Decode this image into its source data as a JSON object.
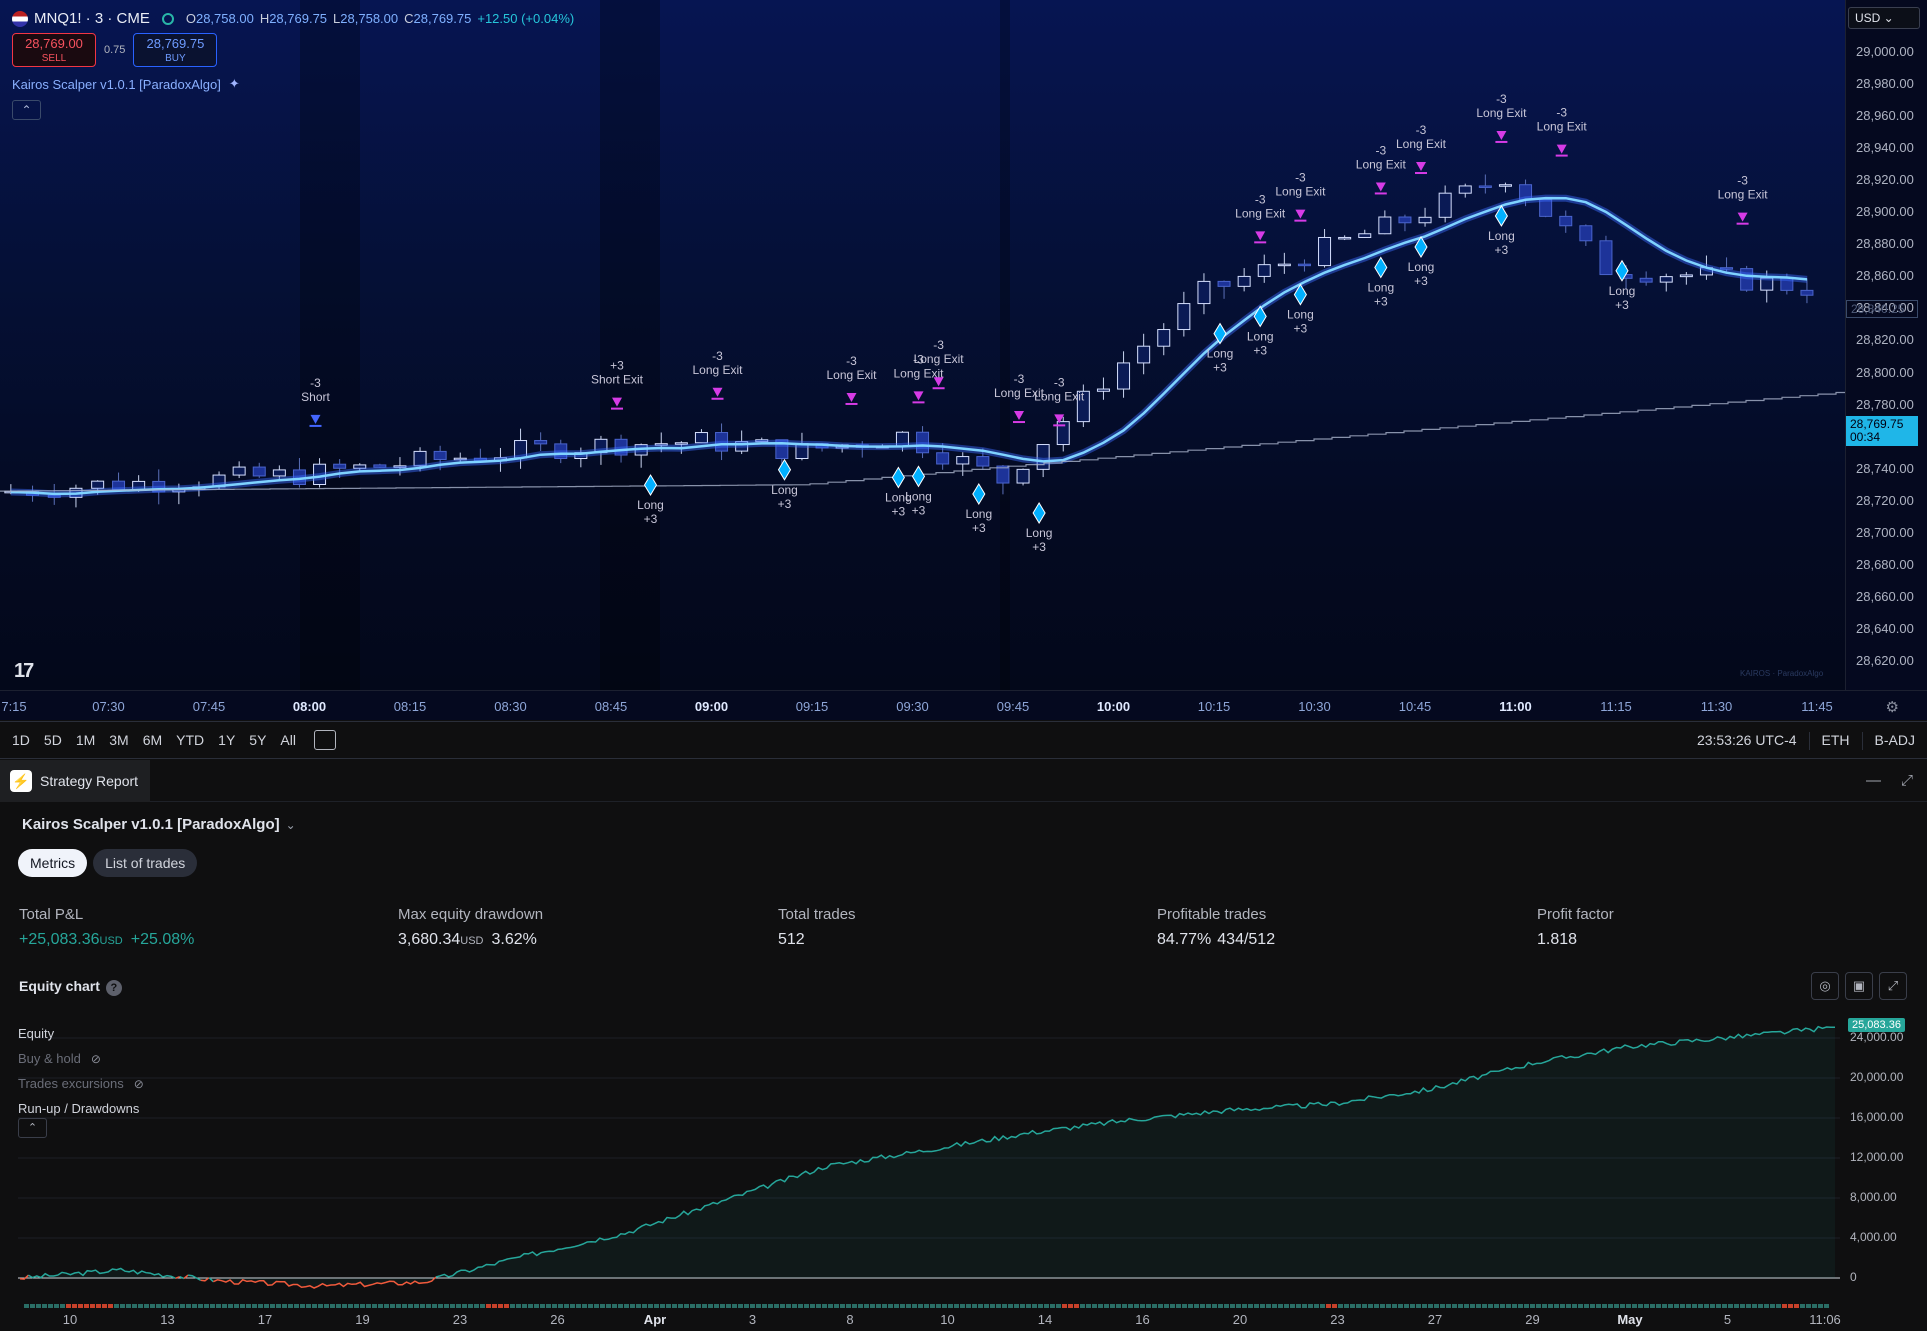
{
  "header": {
    "symbol": "MNQ1! · 3 · CME",
    "open": "28,758.00",
    "high": "28,769.75",
    "low": "28,758.00",
    "close": "28,769.75",
    "change": "+12.50 (+0.04%)",
    "sell_price": "28,769.00",
    "sell_label": "SELL",
    "buy_price": "28,769.75",
    "buy_label": "BUY",
    "spread": "0.75",
    "indicator": "Kairos Scalper v1.0.1 [ParadoxAlgo]"
  },
  "price_axis": {
    "currency": "USD",
    "ticks": [
      "29,000.00",
      "28,980.00",
      "28,960.00",
      "28,940.00",
      "28,920.00",
      "28,900.00",
      "28,880.00",
      "28,860.00",
      "28,840.00",
      "28,820.00",
      "28,800.00",
      "28,780.00",
      "28,760.00",
      "28,740.00",
      "28,720.00",
      "28,700.00",
      "28,680.00",
      "28,660.00",
      "28,640.00",
      "28,620.00"
    ],
    "current_price": "28,769.75",
    "countdown": "00:34",
    "ghost_price": "28,840.25"
  },
  "time_axis": {
    "ticks": [
      {
        "label": "7:15",
        "bold": false
      },
      {
        "label": "07:30",
        "bold": false
      },
      {
        "label": "07:45",
        "bold": false
      },
      {
        "label": "08:00",
        "bold": true
      },
      {
        "label": "08:15",
        "bold": false
      },
      {
        "label": "08:30",
        "bold": false
      },
      {
        "label": "08:45",
        "bold": false
      },
      {
        "label": "09:00",
        "bold": true
      },
      {
        "label": "09:15",
        "bold": false
      },
      {
        "label": "09:30",
        "bold": false
      },
      {
        "label": "09:45",
        "bold": false
      },
      {
        "label": "10:00",
        "bold": true
      },
      {
        "label": "10:15",
        "bold": false
      },
      {
        "label": "10:30",
        "bold": false
      },
      {
        "label": "10:45",
        "bold": false
      },
      {
        "label": "11:00",
        "bold": true
      },
      {
        "label": "11:15",
        "bold": false
      },
      {
        "label": "11:30",
        "bold": false
      },
      {
        "label": "11:45",
        "bold": false
      }
    ]
  },
  "chart_data": [
    {
      "type": "candlestick",
      "title": "MNQ1! · 3 · CME",
      "ylim": [
        28610,
        29010
      ],
      "series": [
        {
          "name": "close_approx",
          "x": [
            "07:15",
            "07:30",
            "07:45",
            "08:00",
            "08:15",
            "08:30",
            "08:45",
            "09:00",
            "09:15",
            "09:30",
            "09:45",
            "10:00",
            "10:15",
            "10:30",
            "10:45",
            "11:00",
            "11:15",
            "11:30",
            "11:45"
          ],
          "values": [
            28720,
            28725,
            28728,
            28731,
            28738,
            28745,
            28750,
            28752,
            28746,
            28756,
            28728,
            28790,
            28845,
            28868,
            28890,
            28918,
            28860,
            28855,
            28848
          ]
        }
      ],
      "trade_markers": [
        {
          "label": "Short",
          "qty": "-3",
          "x": "08:00"
        },
        {
          "label": "Short Exit",
          "qty": "+3",
          "x": "08:45"
        },
        {
          "label": "Long",
          "qty": "+3",
          "x": "08:50"
        },
        {
          "label": "Long Exit",
          "qty": "-3",
          "x": "09:00"
        },
        {
          "label": "Long",
          "qty": "+3",
          "x": "09:10"
        },
        {
          "label": "Long Exit",
          "qty": "-3",
          "x": "09:20"
        },
        {
          "label": "Long",
          "qty": "+3",
          "x": "09:27"
        },
        {
          "label": "Long Exit",
          "qty": "-3",
          "x": "09:30"
        },
        {
          "label": "Long",
          "qty": "+3",
          "x": "09:30"
        },
        {
          "label": "Long Exit",
          "qty": "-3",
          "x": "09:33"
        },
        {
          "label": "Long",
          "qty": "+3",
          "x": "09:39"
        },
        {
          "label": "Long Exit",
          "qty": "-3",
          "x": "09:45"
        },
        {
          "label": "Long",
          "qty": "+3",
          "x": "09:48"
        },
        {
          "label": "Long Exit",
          "qty": "-3",
          "x": "09:51"
        },
        {
          "label": "Long",
          "qty": "+3",
          "x": "10:15"
        },
        {
          "label": "Long Exit",
          "qty": "-3",
          "x": "10:21"
        },
        {
          "label": "Long",
          "qty": "+3",
          "x": "10:21"
        },
        {
          "label": "Long Exit",
          "qty": "-3",
          "x": "10:27"
        },
        {
          "label": "Long",
          "qty": "+3",
          "x": "10:27"
        },
        {
          "label": "Long Exit",
          "qty": "-3",
          "x": "10:39"
        },
        {
          "label": "Long",
          "qty": "+3",
          "x": "10:39"
        },
        {
          "label": "Long Exit",
          "qty": "-3",
          "x": "10:45"
        },
        {
          "label": "Long",
          "qty": "+3",
          "x": "10:45"
        },
        {
          "label": "Long Exit",
          "qty": "-3",
          "x": "10:57"
        },
        {
          "label": "Long",
          "qty": "+3",
          "x": "10:57"
        },
        {
          "label": "Long Exit",
          "qty": "-3",
          "x": "11:06"
        },
        {
          "label": "Long",
          "qty": "+3",
          "x": "11:15"
        },
        {
          "label": "Long Exit",
          "qty": "-3",
          "x": "11:33"
        }
      ]
    },
    {
      "type": "area",
      "title": "Equity chart",
      "ylabel": "",
      "ylim": [
        -2000,
        26000
      ],
      "yticks": [
        "24,000.00",
        "20,000.00",
        "16,000.00",
        "12,000.00",
        "8,000.00",
        "4,000.00",
        "0"
      ],
      "categories": [
        "10",
        "13",
        "17",
        "19",
        "23",
        "26",
        "Apr",
        "3",
        "8",
        "10",
        "14",
        "16",
        "20",
        "23",
        "27",
        "29",
        "May",
        "5",
        "11:06"
      ],
      "series": [
        {
          "name": "Equity",
          "values": [
            0,
            800,
            -300,
            -800,
            -400,
            2200,
            4500,
            7800,
            11200,
            12800,
            14500,
            15800,
            16800,
            17400,
            18900,
            21500,
            23200,
            24100,
            25083.36
          ]
        }
      ],
      "current_value": "25,083.36"
    }
  ],
  "toolbar": {
    "ranges": [
      "1D",
      "5D",
      "1M",
      "3M",
      "6M",
      "YTD",
      "1Y",
      "5Y",
      "All"
    ],
    "clock": "23:53:26 UTC-4",
    "session": "ETH",
    "adjust": "B-ADJ"
  },
  "report": {
    "tab_label": "Strategy Report",
    "strategy_name": "Kairos Scalper v1.0.1 [ParadoxAlgo]",
    "tabs": [
      "Metrics",
      "List of trades"
    ],
    "metrics": [
      {
        "label": "Total P&L",
        "value": "+25,083.36",
        "unit": "USD",
        "extra": "+25.08%",
        "green": true
      },
      {
        "label": "Max equity drawdown",
        "value": "3,680.34",
        "unit": "USD",
        "extra": "3.62%",
        "green": false
      },
      {
        "label": "Total trades",
        "value": "512",
        "unit": "",
        "extra": "",
        "green": false
      },
      {
        "label": "Profitable trades",
        "value": "84.77%",
        "unit": "",
        "extra": "434/512",
        "green": false
      },
      {
        "label": "Profit factor",
        "value": "1.818",
        "unit": "",
        "extra": "",
        "green": false
      }
    ],
    "equity_title": "Equity chart",
    "legend": [
      "Equity",
      "Buy & hold",
      "Trades excursions",
      "Run-up / Drawdowns"
    ]
  },
  "colors": {
    "accent": "#2962ff",
    "positive": "#26a69a",
    "negative": "#f05a3c",
    "long_marker": "#00b0ff",
    "exit_marker": "#d63be6"
  }
}
